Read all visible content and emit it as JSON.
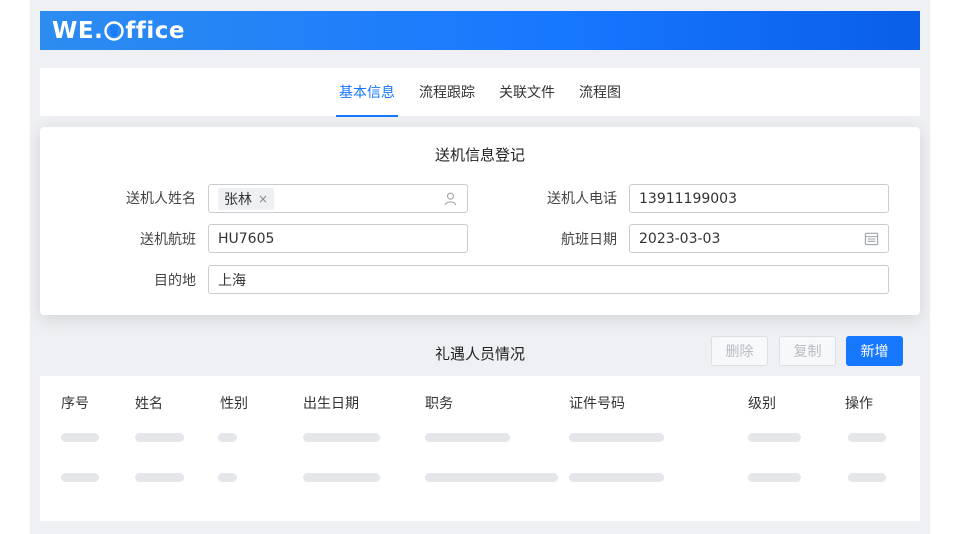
{
  "app": {
    "logo_text_left": "WE.",
    "logo_text_right": "ffice"
  },
  "tabs": [
    {
      "label": "基本信息",
      "active": true
    },
    {
      "label": "流程跟踪",
      "active": false
    },
    {
      "label": "关联文件",
      "active": false
    },
    {
      "label": "流程图",
      "active": false
    }
  ],
  "form": {
    "title": "送机信息登记",
    "sender_name": {
      "label": "送机人姓名",
      "tag": "张林",
      "tag_close": "×"
    },
    "sender_phone": {
      "label": "送机人电话",
      "value": "13911199003"
    },
    "flight": {
      "label": "送机航班",
      "value": "HU7605"
    },
    "flight_date": {
      "label": "航班日期",
      "value": "2023-03-03"
    },
    "destination": {
      "label": "目的地",
      "value": "上海"
    }
  },
  "guests": {
    "title": "礼遇人员情况",
    "buttons": {
      "delete": "删除",
      "copy": "复制",
      "add": "新增"
    },
    "columns": [
      "序号",
      "姓名",
      "性别",
      "出生日期",
      "职务",
      "证件号码",
      "级别",
      "操作"
    ]
  },
  "colors": {
    "accent": "#1677ff",
    "header_gradient_end": "#0a5ee8"
  },
  "icons": {
    "sender_name": "user-icon",
    "flight_date": "calendar-icon"
  }
}
